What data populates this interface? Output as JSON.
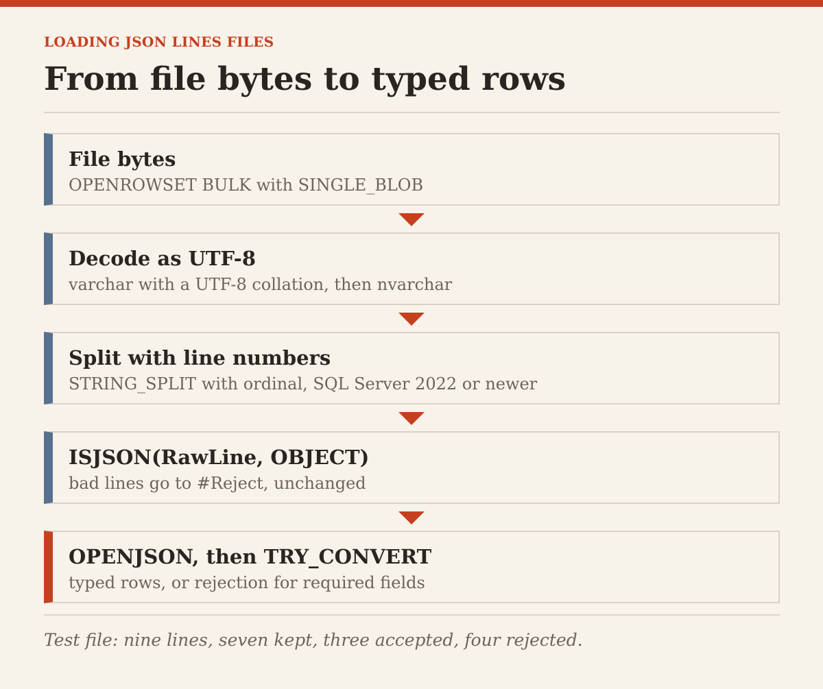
{
  "header": {
    "eyebrow": "LOADING JSON LINES FILES",
    "title": "From file bytes to typed rows"
  },
  "colors": {
    "accent": "#c5401f",
    "step_bar": "#56708e",
    "background": "#f8f3ea"
  },
  "steps": [
    {
      "title": "File bytes",
      "description": "OPENROWSET BULK with SINGLE_BLOB"
    },
    {
      "title": "Decode as UTF-8",
      "description": "varchar with a UTF-8 collation, then nvarchar"
    },
    {
      "title": "Split with line numbers",
      "description": "STRING_SPLIT with ordinal, SQL Server 2022 or newer"
    },
    {
      "title": "ISJSON(RawLine, OBJECT)",
      "description": "bad lines go to #Reject, unchanged"
    },
    {
      "title": "OPENJSON, then TRY_CONVERT",
      "description": "typed rows, or rejection for required fields"
    }
  ],
  "footnote": "Test file: nine lines, seven kept, three accepted, four rejected."
}
